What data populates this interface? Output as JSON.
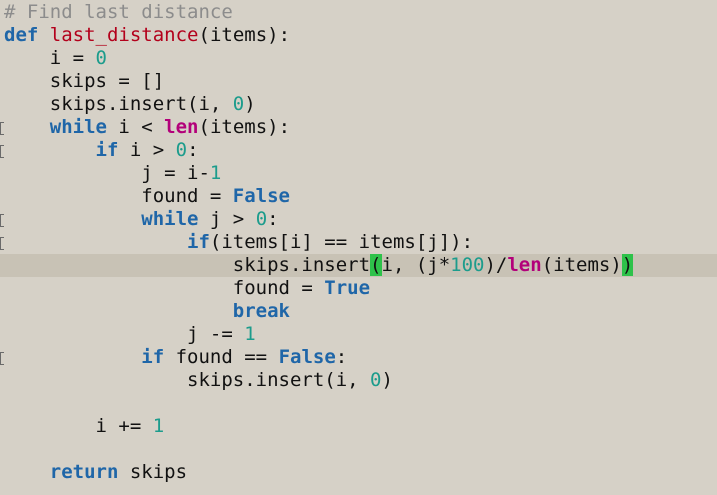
{
  "editor": {
    "current_line_index": 11,
    "lines": [
      {
        "marker": false,
        "tokens": [
          {
            "t": "# Find last distance",
            "k": "comment"
          }
        ]
      },
      {
        "marker": false,
        "tokens": [
          {
            "t": "def",
            "k": "keyword"
          },
          {
            "t": " ",
            "k": "text"
          },
          {
            "t": "last_distance",
            "k": "func"
          },
          {
            "t": "(items):",
            "k": "text"
          }
        ]
      },
      {
        "marker": false,
        "tokens": [
          {
            "t": "    i = ",
            "k": "text"
          },
          {
            "t": "0",
            "k": "number"
          }
        ]
      },
      {
        "marker": false,
        "tokens": [
          {
            "t": "    skips = []",
            "k": "text"
          }
        ]
      },
      {
        "marker": false,
        "tokens": [
          {
            "t": "    skips.insert(i, ",
            "k": "text"
          },
          {
            "t": "0",
            "k": "number"
          },
          {
            "t": ")",
            "k": "text"
          }
        ]
      },
      {
        "marker": true,
        "tokens": [
          {
            "t": "    ",
            "k": "text"
          },
          {
            "t": "while",
            "k": "keyword"
          },
          {
            "t": " i < ",
            "k": "text"
          },
          {
            "t": "len",
            "k": "builtin"
          },
          {
            "t": "(items):",
            "k": "text"
          }
        ]
      },
      {
        "marker": true,
        "tokens": [
          {
            "t": "        ",
            "k": "text"
          },
          {
            "t": "if",
            "k": "keyword"
          },
          {
            "t": " i > ",
            "k": "text"
          },
          {
            "t": "0",
            "k": "number"
          },
          {
            "t": ":",
            "k": "text"
          }
        ]
      },
      {
        "marker": false,
        "tokens": [
          {
            "t": "            j = i-",
            "k": "text"
          },
          {
            "t": "1",
            "k": "number"
          }
        ]
      },
      {
        "marker": false,
        "tokens": [
          {
            "t": "            found = ",
            "k": "text"
          },
          {
            "t": "False",
            "k": "const"
          }
        ]
      },
      {
        "marker": true,
        "tokens": [
          {
            "t": "            ",
            "k": "text"
          },
          {
            "t": "while",
            "k": "keyword"
          },
          {
            "t": " j > ",
            "k": "text"
          },
          {
            "t": "0",
            "k": "number"
          },
          {
            "t": ":",
            "k": "text"
          }
        ]
      },
      {
        "marker": true,
        "tokens": [
          {
            "t": "                ",
            "k": "text"
          },
          {
            "t": "if",
            "k": "keyword"
          },
          {
            "t": "(items[i] == items[j]):",
            "k": "text"
          }
        ]
      },
      {
        "marker": false,
        "tokens": [
          {
            "t": "                    skips.insert",
            "k": "text"
          },
          {
            "t": "(",
            "k": "bracket"
          },
          {
            "t": "i, (j*",
            "k": "text"
          },
          {
            "t": "100",
            "k": "number"
          },
          {
            "t": ")/",
            "k": "text"
          },
          {
            "t": "len",
            "k": "builtin"
          },
          {
            "t": "(items)",
            "k": "text"
          },
          {
            "t": ")",
            "k": "bracket"
          }
        ]
      },
      {
        "marker": false,
        "tokens": [
          {
            "t": "                    found = ",
            "k": "text"
          },
          {
            "t": "True",
            "k": "const"
          }
        ]
      },
      {
        "marker": false,
        "tokens": [
          {
            "t": "                    ",
            "k": "text"
          },
          {
            "t": "break",
            "k": "keyword"
          }
        ]
      },
      {
        "marker": false,
        "tokens": [
          {
            "t": "                j -= ",
            "k": "text"
          },
          {
            "t": "1",
            "k": "number"
          }
        ]
      },
      {
        "marker": true,
        "tokens": [
          {
            "t": "            ",
            "k": "text"
          },
          {
            "t": "if",
            "k": "keyword"
          },
          {
            "t": " found == ",
            "k": "text"
          },
          {
            "t": "False",
            "k": "const"
          },
          {
            "t": ":",
            "k": "text"
          }
        ]
      },
      {
        "marker": false,
        "tokens": [
          {
            "t": "                skips.insert(i, ",
            "k": "text"
          },
          {
            "t": "0",
            "k": "number"
          },
          {
            "t": ")",
            "k": "text"
          }
        ]
      },
      {
        "marker": false,
        "tokens": [
          {
            "t": "",
            "k": "text"
          }
        ]
      },
      {
        "marker": false,
        "tokens": [
          {
            "t": "        i += ",
            "k": "text"
          },
          {
            "t": "1",
            "k": "number"
          }
        ]
      },
      {
        "marker": false,
        "tokens": [
          {
            "t": "",
            "k": "text"
          }
        ]
      },
      {
        "marker": false,
        "tokens": [
          {
            "t": "    ",
            "k": "text"
          },
          {
            "t": "return",
            "k": "keyword"
          },
          {
            "t": " skips",
            "k": "text"
          }
        ]
      }
    ]
  }
}
